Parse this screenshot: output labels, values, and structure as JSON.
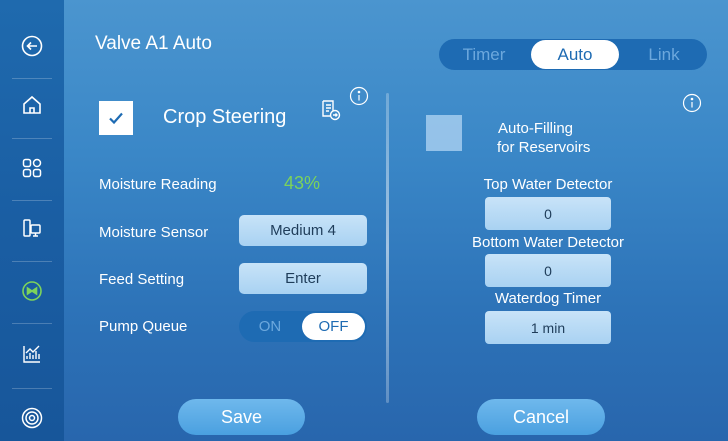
{
  "title": "Valve A1 Auto",
  "mode_tabs": [
    {
      "label": "Timer",
      "active": false
    },
    {
      "label": "Auto",
      "active": true
    },
    {
      "label": "Link",
      "active": false
    }
  ],
  "sidebar": {
    "items": [
      {
        "icon": "back-arrow-icon"
      },
      {
        "icon": "home-icon"
      },
      {
        "icon": "grid-icon"
      },
      {
        "icon": "tower-icon"
      },
      {
        "icon": "valve-icon",
        "active": true
      },
      {
        "icon": "chart-icon"
      },
      {
        "icon": "target-icon"
      }
    ]
  },
  "crop_steering": {
    "label": "Crop Steering",
    "checked": true
  },
  "rows": {
    "moisture_reading_label": "Moisture Reading",
    "moisture_reading_value": "43%",
    "moisture_sensor_label": "Moisture Sensor",
    "moisture_sensor_value": "Medium 4",
    "feed_setting_label": "Feed Setting",
    "feed_setting_value": "Enter",
    "pump_queue_label": "Pump Queue",
    "pump_queue_on": "ON",
    "pump_queue_off": "OFF",
    "pump_queue_state": "OFF"
  },
  "autofill": {
    "line1": "Auto-Filling",
    "line2": "for Reservoirs",
    "checked": false
  },
  "top_detector": {
    "label": "Top Water Detector",
    "value": "0"
  },
  "bottom_detector": {
    "label": "Bottom Water Detector",
    "value": "0"
  },
  "waterdog": {
    "label": "Waterdog Timer",
    "value": "1 min"
  },
  "buttons": {
    "save": "Save",
    "cancel": "Cancel"
  },
  "colors": {
    "accent_green": "#7cd35b",
    "segment_bg": "#1e6bb3",
    "field_bg": "#b9dbf5"
  }
}
